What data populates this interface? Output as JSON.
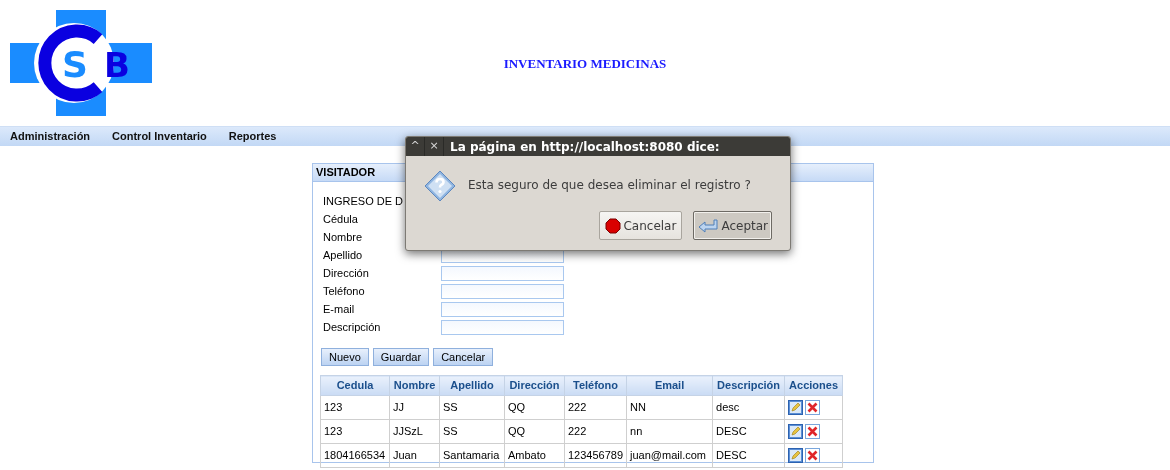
{
  "logo": {
    "letters": [
      "S",
      "B"
    ]
  },
  "title": "INVENTARIO MEDICINAS",
  "menu": [
    {
      "label": "Administración"
    },
    {
      "label": "Control Inventario"
    },
    {
      "label": "Reportes"
    }
  ],
  "panel": {
    "title": "VISITADOR",
    "section": "INGRESO DE D",
    "fields": [
      {
        "label": "Cédula",
        "has_input": false
      },
      {
        "label": "Nombre",
        "has_input": false
      },
      {
        "label": "Apellido",
        "has_input": true
      },
      {
        "label": "Dirección",
        "has_input": true
      },
      {
        "label": "Teléfono",
        "has_input": true
      },
      {
        "label": "E-mail",
        "has_input": true
      },
      {
        "label": "Descripción",
        "has_input": true
      }
    ],
    "buttons": [
      "Nuevo",
      "Guardar",
      "Cancelar"
    ],
    "table": {
      "columns": [
        "Cedula",
        "Nombre",
        "Apellido",
        "Dirección",
        "Teléfono",
        "Email",
        "Descripción",
        "Acciones"
      ],
      "rows": [
        [
          "123",
          "JJ",
          "SS",
          "QQ",
          "222",
          "NN",
          "desc"
        ],
        [
          "123",
          "JJSzL",
          "SS",
          "QQ",
          "222",
          "nn",
          "DESC"
        ],
        [
          "1804166534",
          "Juan",
          "Santamaria",
          "Ambato",
          "123456789",
          "juan@mail.com",
          "DESC"
        ]
      ]
    }
  },
  "dialog": {
    "controls": [
      "^",
      "×"
    ],
    "title": "La página en http://localhost:8080 dice:",
    "message": "Esta seguro de que desea eliminar el registro ?",
    "buttons": [
      {
        "label": "Cancelar",
        "kind": "cancel",
        "focused": false
      },
      {
        "label": "Aceptar",
        "kind": "accept",
        "focused": true
      }
    ]
  }
}
